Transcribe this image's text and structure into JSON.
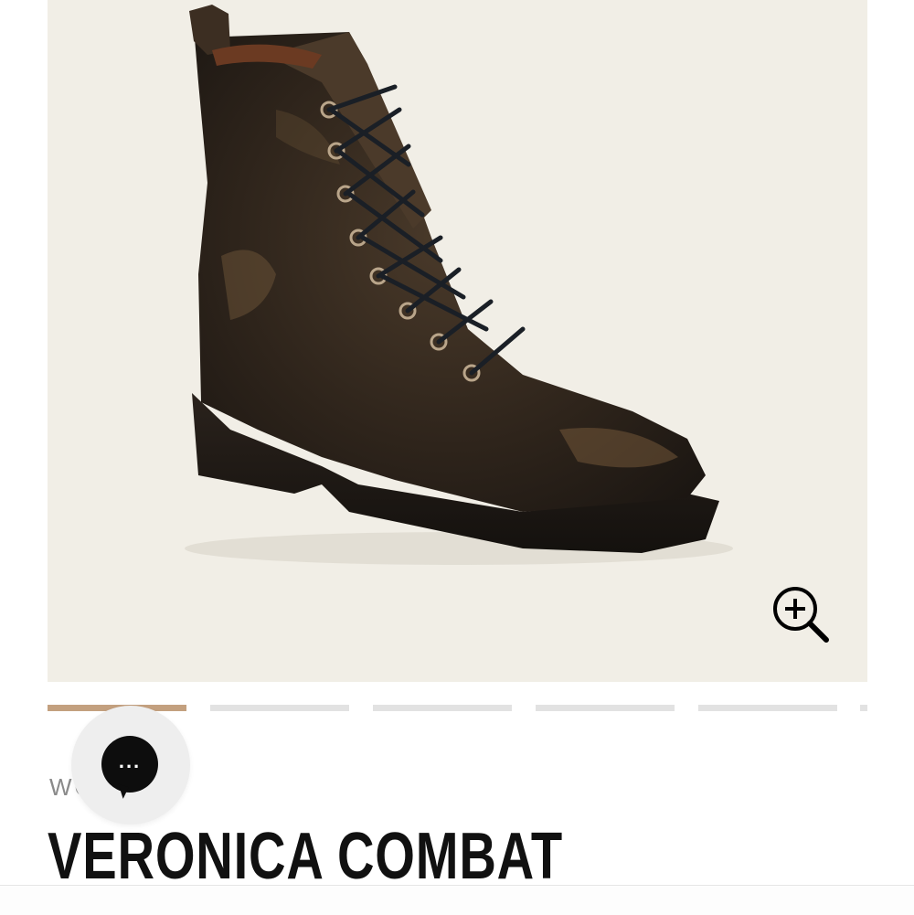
{
  "product": {
    "category": "WOMEN",
    "title": "VERONICA COMBAT"
  },
  "gallery": {
    "image_alt": "Veronica Combat boot in distressed black leather",
    "zoom_icon": "zoom-in-icon",
    "slides_count": 6,
    "active_slide": 1
  },
  "chat": {
    "icon": "chat-bubble-icon",
    "label": "..."
  },
  "colors": {
    "hero_bg": "#f1eee6",
    "progress_active": "#c3a07f",
    "progress_inactive": "#e2e2e2",
    "title": "#111111"
  }
}
